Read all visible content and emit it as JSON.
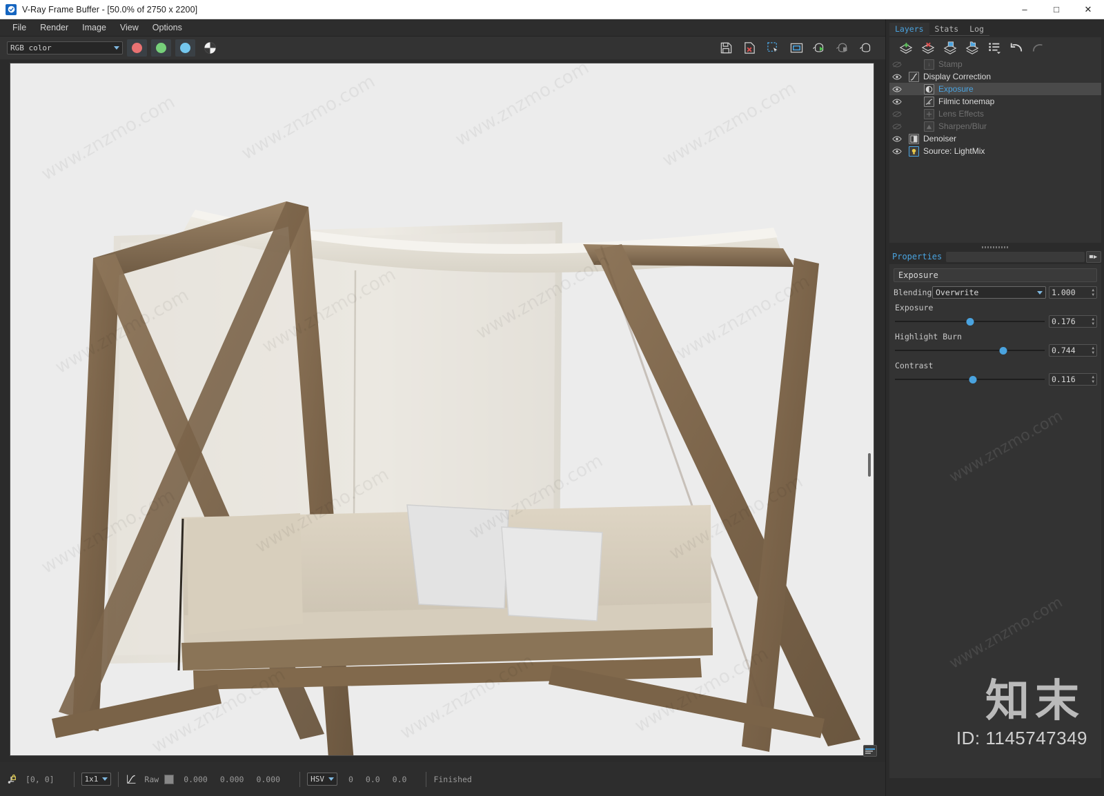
{
  "window": {
    "title": "V-Ray Frame Buffer - [50.0% of 2750 x 2200]",
    "app_icon": "vray-icon",
    "minimize": "–",
    "maximize": "□",
    "close": "✕"
  },
  "menubar": {
    "items": [
      {
        "label": "File"
      },
      {
        "label": "Render"
      },
      {
        "label": "Image"
      },
      {
        "label": "View"
      },
      {
        "label": "Options"
      }
    ]
  },
  "toolbar": {
    "channel_select": {
      "value": "RGB color"
    },
    "channels": [
      {
        "name": "red-channel-button",
        "color": "#e87272"
      },
      {
        "name": "green-channel-button",
        "color": "#76d07a"
      },
      {
        "name": "blue-channel-button",
        "color": "#74c7ee"
      }
    ],
    "alpha_button": "alpha-channel-icon",
    "right_buttons": [
      {
        "name": "save-image-button",
        "icon": "save-icon"
      },
      {
        "name": "clear-image-button",
        "icon": "clear-image-icon"
      },
      {
        "name": "region-render-button",
        "icon": "region-select-icon"
      },
      {
        "name": "fit-to-window-button",
        "icon": "fit-window-icon"
      },
      {
        "name": "start-render-button",
        "icon": "teapot-play-icon"
      },
      {
        "name": "stop-render-button",
        "icon": "teapot-stop-icon"
      },
      {
        "name": "resume-render-button",
        "icon": "teapot-resume-icon"
      }
    ]
  },
  "statusbar": {
    "lock_icon": "pixel-lock-icon",
    "coordinates": "[0,  0]",
    "sample_size": "1x1",
    "curve_icon": "curve-icon",
    "raw_label": "Raw",
    "color_swatch": "#888888",
    "rgb_values": [
      "0.000",
      "0.000",
      "0.000"
    ],
    "color_mode": "HSV",
    "hsv_values": [
      "0",
      "0.0",
      "0.0"
    ],
    "render_status": "Finished"
  },
  "dock": {
    "tabs": [
      {
        "label": "Layers",
        "active": true
      },
      {
        "label": "Stats",
        "active": false
      },
      {
        "label": "Log",
        "active": false
      }
    ],
    "layer_toolbar": [
      {
        "name": "add-layer-button",
        "icon": "add-layer-icon"
      },
      {
        "name": "delete-layer-button",
        "icon": "delete-layer-icon"
      },
      {
        "name": "save-layer-button",
        "icon": "save-layer-icon"
      },
      {
        "name": "load-layer-button",
        "icon": "load-layer-icon"
      },
      {
        "name": "layer-presets-button",
        "icon": "list-icon"
      },
      {
        "name": "undo-button",
        "icon": "undo-icon"
      },
      {
        "name": "redo-button",
        "icon": "redo-icon"
      }
    ],
    "layers": [
      {
        "label": "Stamp",
        "icon": "stamp-icon",
        "visible": false,
        "enabled": false,
        "selected": false,
        "indent": 1
      },
      {
        "label": "Display Correction",
        "icon": "curve-icon",
        "visible": true,
        "enabled": true,
        "selected": false,
        "indent": 0
      },
      {
        "label": "Exposure",
        "icon": "exposure-icon",
        "visible": true,
        "enabled": true,
        "selected": true,
        "indent": 1
      },
      {
        "label": "Filmic tonemap",
        "icon": "filmic-icon",
        "visible": true,
        "enabled": true,
        "selected": false,
        "indent": 1
      },
      {
        "label": "Lens Effects",
        "icon": "lens-effects-icon",
        "visible": false,
        "enabled": false,
        "selected": false,
        "indent": 1
      },
      {
        "label": "Sharpen/Blur",
        "icon": "sharpen-blur-icon",
        "visible": false,
        "enabled": false,
        "selected": false,
        "indent": 1
      },
      {
        "label": "Denoiser",
        "icon": "denoiser-icon",
        "visible": true,
        "enabled": true,
        "selected": false,
        "indent": 0
      },
      {
        "label": "Source: LightMix",
        "icon": "lightmix-icon",
        "visible": true,
        "enabled": true,
        "selected": false,
        "indent": 0
      }
    ],
    "properties": {
      "title": "Properties",
      "collapse_icon": "collapse-panel-icon",
      "layer_name": "Exposure",
      "blending": {
        "label": "Blending",
        "value": "Overwrite",
        "amount": "1.000"
      },
      "sliders": [
        {
          "label": "Exposure",
          "value": "0.176",
          "pct": 50
        },
        {
          "label": "Highlight Burn",
          "value": "0.744",
          "pct": 72
        },
        {
          "label": "Contrast",
          "value": "0.116",
          "pct": 52
        }
      ]
    }
  },
  "watermark": {
    "text": "www.znzmo.com",
    "logo": "知末",
    "id": "ID: 1145747349"
  },
  "colors": {
    "accent": "#4aa3df",
    "panel": "#333333",
    "window": "#2b2b2b",
    "canvas": "#ececec"
  }
}
